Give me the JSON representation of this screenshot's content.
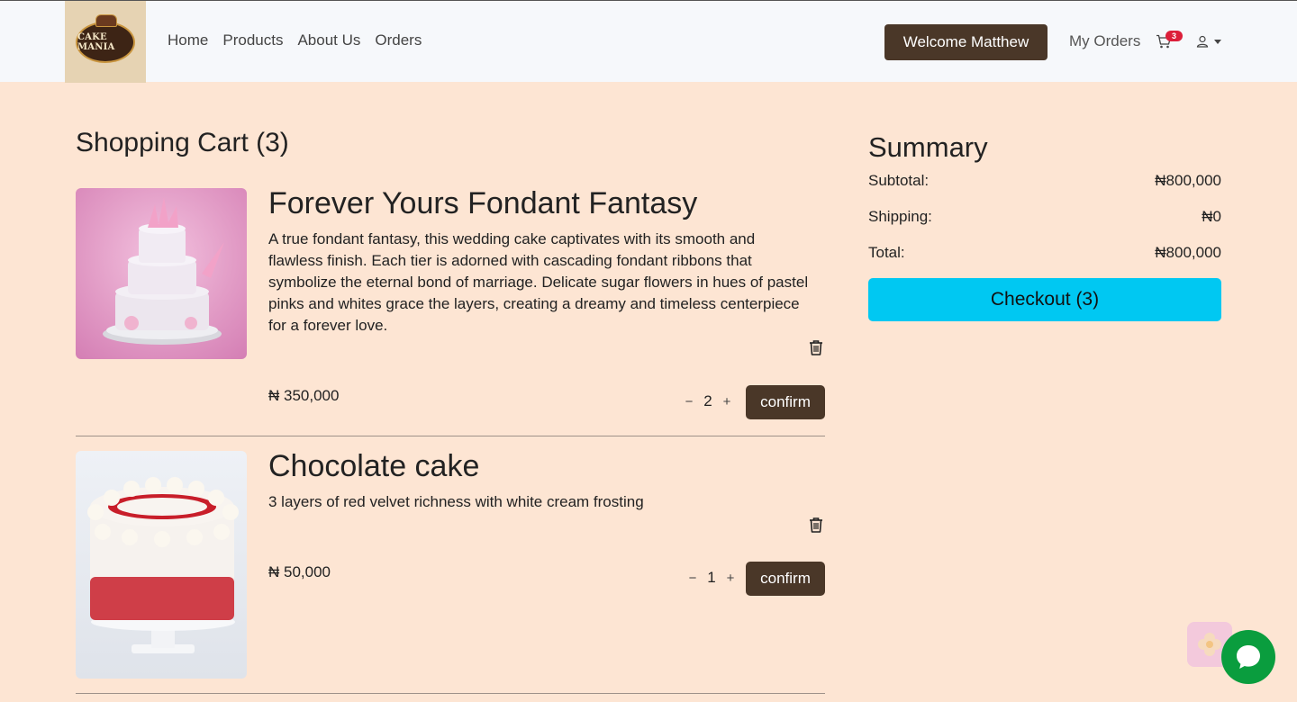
{
  "brand": {
    "logo_text": "CAKE MANIA"
  },
  "nav": {
    "links": [
      "Home",
      "Products",
      "About Us",
      "Orders"
    ],
    "welcome": "Welcome Matthew",
    "my_orders": "My Orders",
    "cart_count": "3",
    "icons": {
      "cart": "cart-icon",
      "user": "user-icon"
    }
  },
  "cart": {
    "title": "Shopping Cart (3)",
    "items": [
      {
        "title": "Forever Yours Fondant Fantasy",
        "description": "A true fondant fantasy, this wedding cake captivates with its smooth and flawless finish. Each tier is adorned with cascading fondant ribbons that symbolize the eternal bond of marriage. Delicate sugar flowers in hues of pastel pinks and whites grace the layers, creating a dreamy and timeless centerpiece for a forever love.",
        "price": "₦ 350,000",
        "quantity": "2",
        "confirm_label": "confirm",
        "minus": "−",
        "plus": "+"
      },
      {
        "title": "Chocolate cake",
        "description": "3 layers of red velvet richness with white cream frosting",
        "price": "₦ 50,000",
        "quantity": "1",
        "confirm_label": "confirm",
        "minus": "−",
        "plus": "+"
      }
    ]
  },
  "summary": {
    "title": "Summary",
    "subtotal_label": "Subtotal:",
    "subtotal_value": "₦800,000",
    "shipping_label": "Shipping:",
    "shipping_value": "₦0",
    "total_label": "Total:",
    "total_value": "₦800,000",
    "checkout_label": "Checkout (3)"
  },
  "colors": {
    "page_bg": "#fde5d3",
    "navbar_bg": "#f6f8fb",
    "brown_button": "#4a3728",
    "checkout": "#00c8f2",
    "badge": "#dc1f3a",
    "chat": "#0a9d3e"
  }
}
